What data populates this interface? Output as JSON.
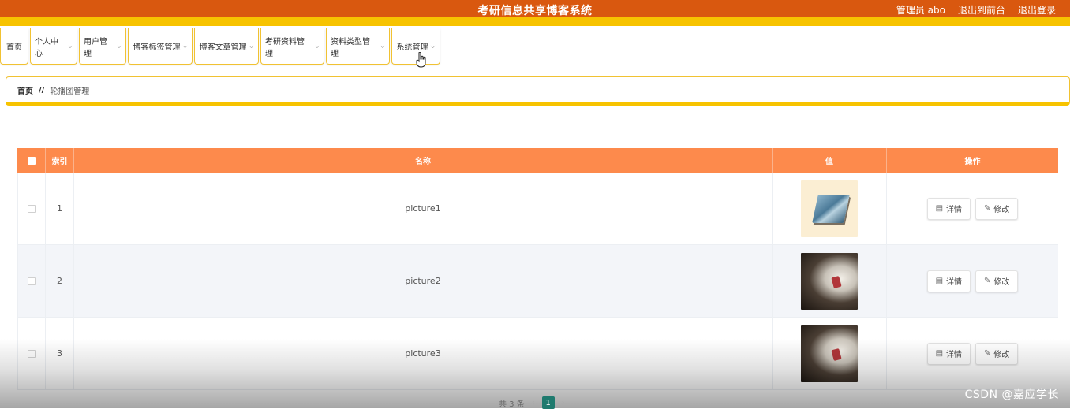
{
  "header": {
    "title": "考研信息共享博客系统",
    "admin_label": "管理员 abo",
    "back_to_front": "退出到前台",
    "logout": "退出登录"
  },
  "nav": {
    "items": [
      {
        "label": "首页",
        "has_dropdown": false
      },
      {
        "label": "个人中心",
        "has_dropdown": true
      },
      {
        "label": "用户管理",
        "has_dropdown": true
      },
      {
        "label": "博客标签管理",
        "has_dropdown": true
      },
      {
        "label": "博客文章管理",
        "has_dropdown": true
      },
      {
        "label": "考研资料管理",
        "has_dropdown": true
      },
      {
        "label": "资料类型管理",
        "has_dropdown": true
      },
      {
        "label": "系统管理",
        "has_dropdown": true
      }
    ]
  },
  "breadcrumb": {
    "home": "首页",
    "separator": "//",
    "current": "轮播图管理"
  },
  "table": {
    "columns": {
      "index": "索引",
      "name": "名称",
      "value": "值",
      "actions": "操作"
    },
    "rows": [
      {
        "index": "1",
        "name": "picture1"
      },
      {
        "index": "2",
        "name": "picture2"
      },
      {
        "index": "3",
        "name": "picture3"
      }
    ],
    "detail_label": "详情",
    "edit_label": "修改"
  },
  "pagination": {
    "total_text": "共 3 条",
    "current_page": "1"
  },
  "watermark": "CSDN @嘉应学长",
  "colors": {
    "header_bg": "#d9580f",
    "accent_yellow": "#f7c300",
    "table_header": "#fd8a4c",
    "page_active": "#1f7a6e"
  }
}
